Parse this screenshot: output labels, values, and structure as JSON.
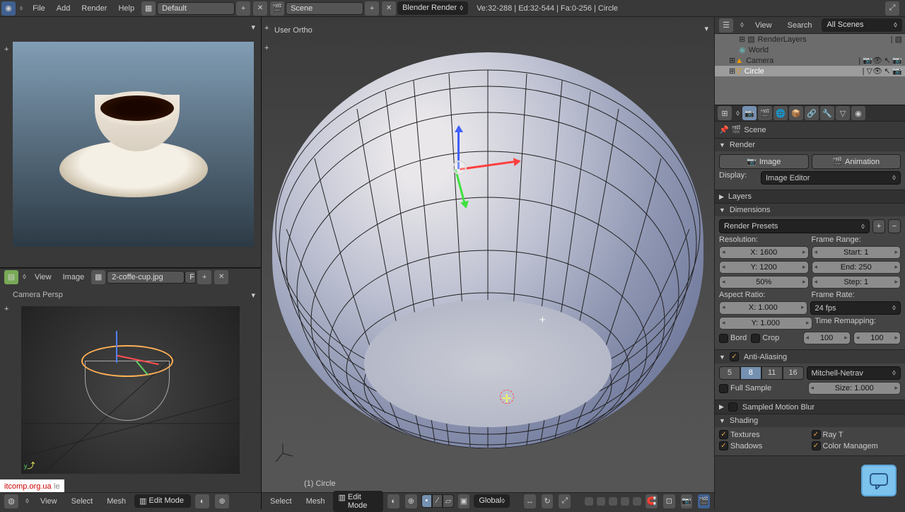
{
  "menu": {
    "file": "File",
    "add": "Add",
    "render": "Render",
    "help": "Help"
  },
  "layout_name": "Default",
  "scene_name": "Scene",
  "engine": "Blender Render",
  "stats": "Ve:32-288 | Ed:32-544 | Fa:0-256 | Circle",
  "viewport": {
    "proj": "User Ortho",
    "object": "(1) Circle"
  },
  "img_editor": {
    "menu_view": "View",
    "menu_image": "Image",
    "filename": "2-coffe-cup.jpg",
    "f": "F"
  },
  "cam_view": {
    "label": "Camera Persp",
    "obj": "le"
  },
  "outliner": {
    "menu_view": "View",
    "menu_search": "Search",
    "scenes": "All Scenes",
    "items": [
      {
        "name": "RenderLayers",
        "indent": 18
      },
      {
        "name": "World",
        "indent": 18
      },
      {
        "name": "Camera",
        "indent": 18
      },
      {
        "name": "Circle",
        "indent": 18
      }
    ]
  },
  "breadcrumb": "Scene",
  "render": {
    "title": "Render",
    "image_btn": "Image",
    "anim_btn": "Animation",
    "display_lbl": "Display:",
    "display_val": "Image Editor"
  },
  "layers": {
    "title": "Layers"
  },
  "dimensions": {
    "title": "Dimensions",
    "presets": "Render Presets",
    "res_lbl": "Resolution:",
    "x": "X: 1600",
    "y": "Y: 1200",
    "pct": "50%",
    "fr_lbl": "Frame Range:",
    "start": "Start: 1",
    "end": "End: 250",
    "step": "Step: 1",
    "ar_lbl": "Aspect Ratio:",
    "ax": "X: 1.000",
    "ay": "Y: 1.000",
    "rate_lbl": "Frame Rate:",
    "rate": "24 fps",
    "remap_lbl": "Time Remapping:",
    "old": "100",
    "new": "100",
    "bord": "Bord",
    "crop": "Crop"
  },
  "aa": {
    "title": "Anti-Aliasing",
    "s5": "5",
    "s8": "8",
    "s11": "11",
    "s16": "16",
    "filter": "Mitchell-Netrav",
    "full": "Full Sample",
    "size": "Size: 1.000"
  },
  "smb": {
    "title": "Sampled Motion Blur"
  },
  "shading": {
    "title": "Shading",
    "tex": "Textures",
    "ray": "Ray T",
    "shad": "Shadows",
    "cm": "Color Managem"
  },
  "footer": {
    "view": "View",
    "select": "Select",
    "mesh": "Mesh",
    "mode": "Edit Mode",
    "global": "Global"
  },
  "watermark": "itcomp.org.ua"
}
